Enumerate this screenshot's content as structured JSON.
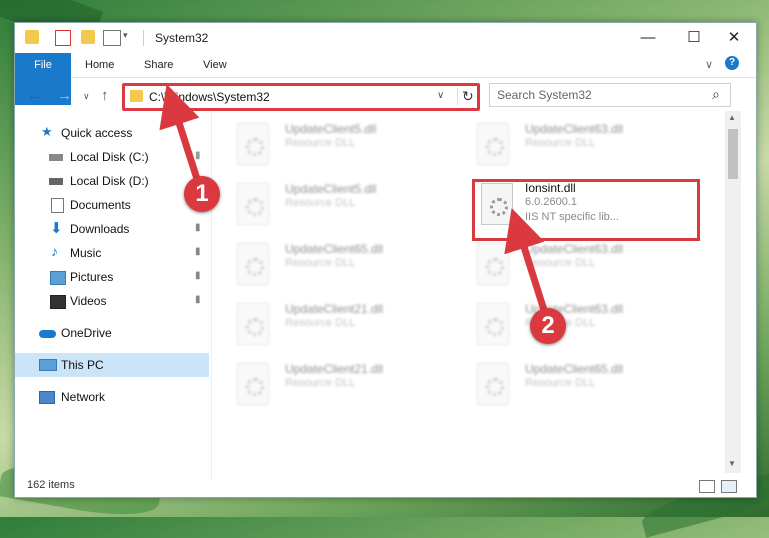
{
  "window": {
    "title": "System32",
    "minimize": "—",
    "maximize": "☐",
    "close": "✕"
  },
  "ribbon": {
    "tabs": [
      "File",
      "Home",
      "Share",
      "View"
    ],
    "collapse": "∨",
    "help": "?"
  },
  "nav": {
    "back": "←",
    "forward": "→",
    "recent": "∨",
    "up": "↑",
    "address": "C:\\Windows\\System32",
    "address_dropdown": "∨",
    "refresh": "↻",
    "search_placeholder": "Search System32",
    "search_icon": "⌕"
  },
  "sidebar": {
    "items": [
      {
        "label": "Quick access",
        "icon": "star-icon"
      },
      {
        "label": "Local Disk (C:)",
        "icon": "drive-icon"
      },
      {
        "label": "Local Disk (D:)",
        "icon": "drive-icon"
      },
      {
        "label": "Documents",
        "icon": "documents-icon"
      },
      {
        "label": "Downloads",
        "icon": "downloads-icon"
      },
      {
        "label": "Music",
        "icon": "music-icon"
      },
      {
        "label": "Pictures",
        "icon": "pictures-icon"
      },
      {
        "label": "Videos",
        "icon": "videos-icon"
      },
      {
        "label": "OneDrive",
        "icon": "cloud-icon"
      },
      {
        "label": "This PC",
        "icon": "computer-icon"
      },
      {
        "label": "Network",
        "icon": "network-icon"
      }
    ],
    "pin": "📌"
  },
  "files": [
    {
      "name": "UpdateClient5.dll",
      "desc": "Resource DLL"
    },
    {
      "name": "UpdateClient63.dll",
      "desc": "Resource DLL"
    },
    {
      "name": "UpdateClient5.dll",
      "desc": "Resource DLL"
    },
    {
      "name": "Ionsint.dll",
      "version": "6.0.2600.1",
      "desc": "IIS NT specific lib..."
    },
    {
      "name": "UpdateClient65.dll",
      "desc": "Resource DLL"
    },
    {
      "name": "UpdateClient63.dll",
      "desc": "Resource DLL"
    },
    {
      "name": "UpdateClient21.dll",
      "desc": "Resource DLL"
    },
    {
      "name": "UpdateClient63.dll",
      "desc": "Resource DLL"
    },
    {
      "name": "UpdateClient21.dll",
      "desc": "Resource DLL"
    },
    {
      "name": "UpdateClient65.dll",
      "desc": "Resource DLL"
    }
  ],
  "status": {
    "items": "162 items"
  },
  "steps": {
    "one": "1",
    "two": "2"
  },
  "colors": {
    "accent": "#1979ca",
    "highlight": "#d9393f"
  }
}
